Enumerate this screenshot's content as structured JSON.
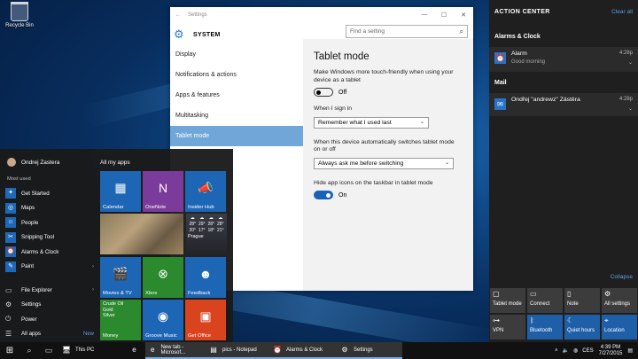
{
  "desktop": {
    "recycle_bin": "Recycle Bin"
  },
  "settings": {
    "window_title": "Settings",
    "section": "SYSTEM",
    "search_placeholder": "Find a setting",
    "nav": [
      "Display",
      "Notifications & actions",
      "Apps & features",
      "Multitasking",
      "Tablet mode"
    ],
    "page_title": "Tablet mode",
    "desc": "Make Windows more touch-friendly when using your device as a tablet",
    "toggle1_state": "Off",
    "signin_label": "When I sign in",
    "signin_value": "Remember what I used last",
    "switch_label": "When this device automatically switches tablet mode on or off",
    "switch_value": "Always ask me before switching",
    "hide_label": "Hide app icons on the taskbar in tablet mode",
    "toggle2_state": "On"
  },
  "start": {
    "user": "Ondrej Zastera",
    "most_used": "Most used",
    "apps": [
      "Get Started",
      "Maps",
      "People",
      "Snipping Tool",
      "Alarms & Clock",
      "Paint"
    ],
    "bottom": [
      "File Explorer",
      "Settings",
      "Power",
      "All apps"
    ],
    "new_badge": "New",
    "all_my_apps": "All my apps",
    "tiles": {
      "calendar": "Calendar",
      "onenote": "OneNote",
      "insider": "Insider Hub",
      "movies": "Movies & TV",
      "xbox": "Xbox",
      "feedback": "Feedback",
      "money": "Money",
      "groove": "Groove Music",
      "office": "Get Office",
      "weather_city": "Prague",
      "weather_temps": [
        "28°",
        "29°",
        "28°",
        "28°"
      ],
      "weather_lows": [
        "20°",
        "17°",
        "18°",
        "21°"
      ],
      "stocks": [
        "Crude Oil",
        "Gold",
        "Silver"
      ]
    }
  },
  "action_center": {
    "title": "ACTION CENTER",
    "clear": "Clear all",
    "group1": "Alarms & Clock",
    "n1_title": "Alarm",
    "n1_sub": "Good morning",
    "n1_time": "4:28p",
    "group2": "Mail",
    "n2_title": "Ondřej \"andrewz\" Zástěra",
    "n2_time": "4:28p",
    "collapse": "Collapse",
    "quick": [
      "Tablet mode",
      "Connect",
      "Note",
      "All settings",
      "VPN",
      "Bluetooth",
      "Quiet hours",
      "Location"
    ]
  },
  "taskbar": {
    "items": [
      "This PC",
      "New tab - Microsof...",
      "pics - Notepad",
      "Alarms & Clock",
      "Settings"
    ],
    "lang": "CES",
    "time": "4:39 PM",
    "date": "7/27/2015"
  },
  "colors": {
    "accent": "#2d7dd2",
    "active_nav": "#71a6d9",
    "action_center_bg": "#1f1f1f"
  }
}
